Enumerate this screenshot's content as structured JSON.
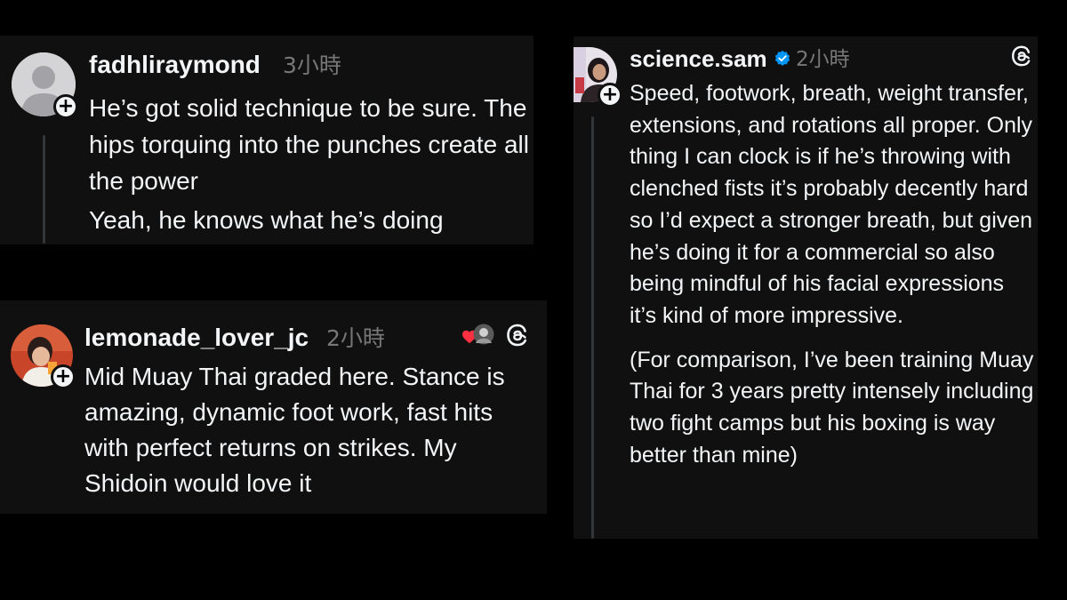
{
  "colors": {
    "page_background": "#000000",
    "card_background": "#101010",
    "text": "#f3f5f7",
    "muted": "#777777",
    "verified_blue": "#0095f6",
    "heart_red": "#ff3040"
  },
  "comments": [
    {
      "username": "fadhliraymond",
      "time": "3小時",
      "avatar_icon": "default-person-avatar",
      "paragraphs": [
        "He’s got solid technique to be sure. The hips torquing into the punches create all the power",
        "Yeah, he knows what he’s doing"
      ]
    },
    {
      "username": "lemonade_lover_jc",
      "time": "2小時",
      "avatar_icon": "user-photo-avatar",
      "liked_by_author": true,
      "paragraphs": [
        "Mid Muay Thai graded here. Stance is amazing, dynamic foot work, fast hits with perfect returns on strikes. My Shidoin would love it"
      ]
    },
    {
      "username": "science.sam",
      "verified": true,
      "time": "2小時",
      "avatar_icon": "user-photo-avatar",
      "paragraphs": [
        "Speed, footwork, breath, weight transfer, extensions, and rotations all proper. Only thing I can clock is if he’s throwing with clenched fists it’s probably decently hard so I’d expect a stronger breath, but given he’s doing it for a commercial so also being mindful of his facial expressions it’s kind of more impressive.",
        "(For comparison, I’ve been training Muay Thai for 3 years pretty intensely including two fight camps but his boxing is way better than mine)"
      ]
    }
  ]
}
